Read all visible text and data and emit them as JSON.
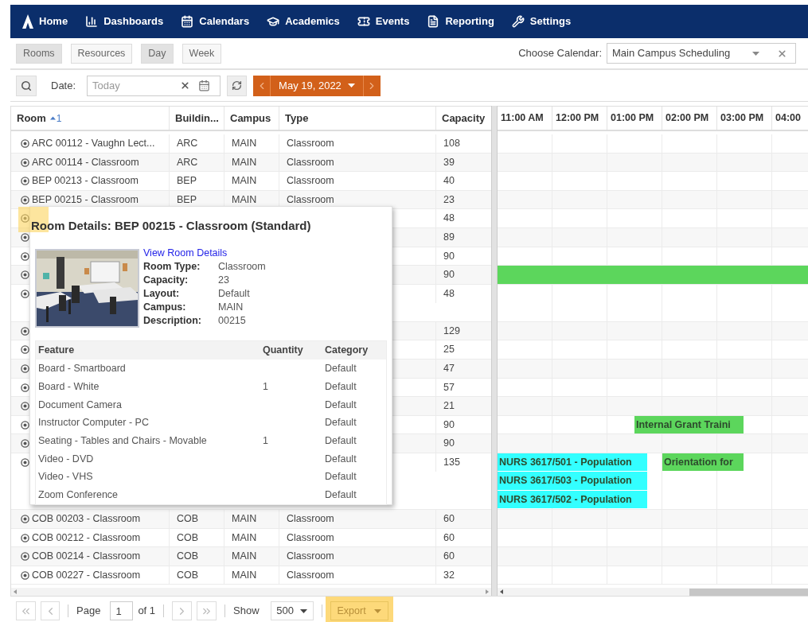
{
  "nav": {
    "items": [
      {
        "label": "Home"
      },
      {
        "label": "Dashboards"
      },
      {
        "label": "Calendars"
      },
      {
        "label": "Academics"
      },
      {
        "label": "Events"
      },
      {
        "label": "Reporting"
      },
      {
        "label": "Settings"
      }
    ]
  },
  "view_tabs": [
    {
      "label": "Rooms",
      "selected": true
    },
    {
      "label": "Resources",
      "selected": false
    },
    {
      "label": "Day",
      "selected": true
    },
    {
      "label": "Week",
      "selected": false
    }
  ],
  "calendar_picker": {
    "label": "Choose Calendar:",
    "value": "Main Campus Scheduling"
  },
  "date_bar": {
    "label": "Date:",
    "placeholder": "Today",
    "current_date": "May 19, 2022"
  },
  "columns": [
    {
      "label": "Room",
      "sorted": true,
      "sort_rank": "1"
    },
    {
      "label": "Buildin...",
      "sorted": false
    },
    {
      "label": "Campus",
      "sorted": false
    },
    {
      "label": "Type",
      "sorted": false
    },
    {
      "label": "Capacity",
      "sorted": false
    }
  ],
  "time_slots": [
    "11:00 AM",
    "12:00 PM",
    "01:00 PM",
    "02:00 PM",
    "03:00 PM",
    "04:00"
  ],
  "rows": [
    {
      "room": "ARC 00112 - Vaughn Lect...",
      "building": "ARC",
      "campus": "MAIN",
      "type": "Classroom",
      "capacity": "108"
    },
    {
      "room": "ARC 00114 - Classroom",
      "building": "ARC",
      "campus": "MAIN",
      "type": "Classroom",
      "capacity": "39"
    },
    {
      "room": "BEP 00213 - Classroom",
      "building": "BEP",
      "campus": "MAIN",
      "type": "Classroom",
      "capacity": "40"
    },
    {
      "room": "BEP 00215 - Classroom",
      "building": "BEP",
      "campus": "MAIN",
      "type": "Classroom",
      "capacity": "23"
    },
    {
      "capacity": "48"
    },
    {
      "capacity": "89"
    },
    {
      "capacity": "90"
    },
    {
      "capacity": "90",
      "events": [
        {
          "color": "#5cd65c"
        }
      ]
    },
    {
      "capacity": "48",
      "tall": true
    },
    {
      "capacity": "129"
    },
    {
      "capacity": "25"
    },
    {
      "capacity": "47"
    },
    {
      "capacity": "57"
    },
    {
      "capacity": "21"
    },
    {
      "capacity": "90",
      "events": [
        {
          "title": "Internal Grant Traini",
          "color": "#5cd65c"
        }
      ]
    },
    {
      "capacity": "90"
    },
    {
      "capacity": "135",
      "events": [
        {
          "title": "NURS 3617/501 - Population",
          "color": "#33ffff"
        },
        {
          "title": "NURS 3617/503 - Population",
          "color": "#33ffff"
        },
        {
          "title": "NURS 3617/502 - Population",
          "color": "#33ffff"
        },
        {
          "title": "Orientation for",
          "color": "#5cd65c"
        }
      ]
    },
    {
      "room": "COB 00203 - Classroom",
      "building": "COB",
      "campus": "MAIN",
      "type": "Classroom",
      "capacity": "60"
    },
    {
      "room": "COB 00212 - Classroom",
      "building": "COB",
      "campus": "MAIN",
      "type": "Classroom",
      "capacity": "60"
    },
    {
      "room": "COB 00214 - Classroom",
      "building": "COB",
      "campus": "MAIN",
      "type": "Classroom",
      "capacity": "60"
    },
    {
      "room": "COB 00227 - Classroom",
      "building": "COB",
      "campus": "MAIN",
      "type": "Classroom",
      "capacity": "32"
    }
  ],
  "popup": {
    "title": "Room Details: BEP 00215 - Classroom (Standard)",
    "highlighted": true,
    "link": "View Room Details",
    "photo": {
      "kind": "picture"
    },
    "details": [
      {
        "label": "Room Type:",
        "value": "Classroom"
      },
      {
        "label": "Capacity:",
        "value": "23"
      },
      {
        "label": "Layout:",
        "value": "Default"
      },
      {
        "label": "Campus:",
        "value": "MAIN"
      },
      {
        "label": "Description:",
        "value": "00215"
      }
    ],
    "feature_columns": [
      "Feature",
      "Quantity",
      "Category"
    ],
    "features": [
      {
        "feature": "Board - Smartboard",
        "category": "Default"
      },
      {
        "feature": "Board - White",
        "quantity": "1",
        "category": "Default"
      },
      {
        "feature": "Document Camera",
        "category": "Default"
      },
      {
        "feature": "Instructor Computer - PC",
        "category": "Default"
      },
      {
        "feature": "Seating - Tables and Chairs - Movable",
        "quantity": "1",
        "category": "Default"
      },
      {
        "feature": "Video - DVD",
        "category": "Default"
      },
      {
        "feature": "Video - VHS",
        "category": "Default"
      },
      {
        "feature": "Zoom Conference",
        "category": "Default"
      }
    ]
  },
  "footer": {
    "page_label": "Page",
    "page": "1",
    "of": "of 1",
    "show_label": "Show",
    "page_size": "500",
    "export": {
      "label": "Export",
      "highlighted": true
    }
  }
}
